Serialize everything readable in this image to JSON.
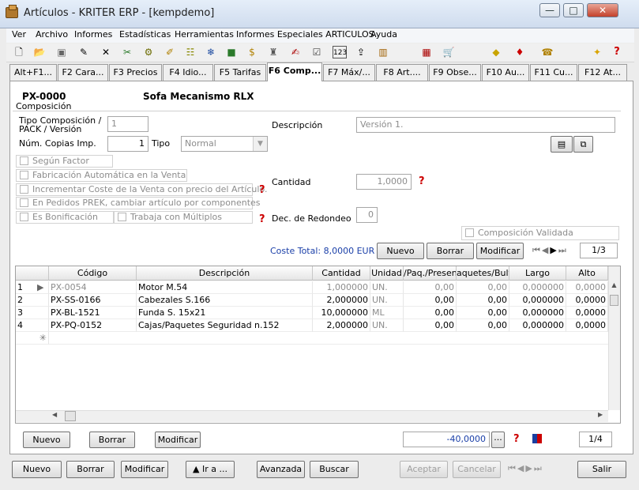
{
  "window": {
    "title": "Artículos - KRITER ERP - [kempdemo]",
    "minimize": "—",
    "maximize": "□",
    "close": "✕"
  },
  "menu": [
    "Ver",
    "Archivo",
    "Informes",
    "Estadísticas",
    "Herramientas",
    "Informes Especiales ARTICULOS",
    "Ayuda"
  ],
  "tabs": [
    "Alt+F1...",
    "F2 Cara...",
    "F3 Precios",
    "F4 Idio...",
    "F5 Tarifas",
    "F6 Comp...",
    "F7 Máx/...",
    "F8 Art....",
    "F9 Obse...",
    "F10 Au...",
    "F11 Cu...",
    "F12 At..."
  ],
  "article": {
    "code": "PX-0000",
    "name": "Sofa Mecanismo RLX"
  },
  "composicion": {
    "group_label": "Composición",
    "tipo_label": "Tipo Composición / PACK / Versión",
    "tipo_value": "1",
    "copias_label": "Núm. Copias Imp.",
    "copias_value": "1",
    "tipo2_label": "Tipo",
    "tipo2_value": "Normal",
    "descripcion_label": "Descripción",
    "descripcion_value": "Versión 1.",
    "cantidad_label": "Cantidad",
    "cantidad_value": "1,0000",
    "redondeo_label": "Dec. de Redondeo",
    "redondeo_value": "0",
    "checks": {
      "segun_factor": "Según Factor",
      "fabricacion": "Fabricación Automática en la Venta",
      "incrementar": "Incrementar Coste de la Venta con precio del Artículo.",
      "pedidos": "En Pedidos PREK, cambiar artículo por componentes",
      "bonificacion": "Es Bonificación",
      "multiplos": "Trabaja con Múltiplos",
      "validada": "Composición Validada"
    },
    "coste_total": "Coste Total: 8,0000 EUR",
    "buttons": {
      "nuevo": "Nuevo",
      "borrar": "Borrar",
      "modificar": "Modificar"
    },
    "record": "1/3"
  },
  "grid": {
    "headers": [
      "Código",
      "Descripción",
      "Cantidad",
      "Unidad",
      "/Paq./Presen",
      "aquetes/Bult",
      "Largo",
      "Alto"
    ],
    "rows": [
      {
        "n": "1",
        "codigo": "PX-0054",
        "descripcion": "Motor M.54",
        "cantidad": "1,000000",
        "unidad": "UN.",
        "paq": "0,00",
        "bult": "0,00",
        "largo": "0,000000",
        "alto": "0,0000"
      },
      {
        "n": "2",
        "codigo": "PX-SS-0166",
        "descripcion": "Cabezales S.166",
        "cantidad": "2,000000",
        "unidad": "UN.",
        "paq": "0,00",
        "bult": "0,00",
        "largo": "0,000000",
        "alto": "0,0000"
      },
      {
        "n": "3",
        "codigo": "PX-BL-1521",
        "descripcion": "Funda S. 15x21",
        "cantidad": "10,000000",
        "unidad": "ML",
        "paq": "0,00",
        "bult": "0,00",
        "largo": "0,000000",
        "alto": "0,0000"
      },
      {
        "n": "4",
        "codigo": "PX-PQ-0152",
        "descripcion": "Cajas/Paquetes Seguridad n.152",
        "cantidad": "2,000000",
        "unidad": "UN.",
        "paq": "0,00",
        "bult": "0,00",
        "largo": "0,000000",
        "alto": "0,0000"
      }
    ],
    "new_row_marker": "✳"
  },
  "lines": {
    "buttons": {
      "nuevo": "Nuevo",
      "borrar": "Borrar",
      "modificar": "Modificar"
    },
    "total": "-40,0000",
    "ellipsis": "...",
    "record": "1/4"
  },
  "footer": {
    "nuevo": "Nuevo",
    "borrar": "Borrar",
    "modificar": "Modificar",
    "ira": "▲  Ir a ...",
    "avanzada": "Avanzada",
    "buscar": "Buscar",
    "aceptar": "Aceptar",
    "cancelar": "Cancelar",
    "salir": "Salir"
  },
  "icons": {
    "accent_red": "#cc0000",
    "link_blue": "#1a3fa8"
  }
}
